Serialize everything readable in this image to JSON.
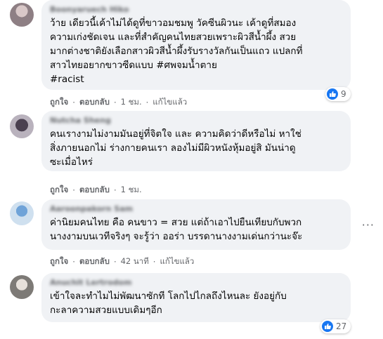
{
  "comments": [
    {
      "author": "Boonyaruech Hiko",
      "text": "ว้าย เดียวนี้เค้าไม่ได้ดูที่ขาวอมชมพู วัคซีนผิวนะ เค้าดูที่สมอง\nความเก่งชัดเจน และที่สำคัญคนไทยสวยเพราะผิวสีน้ำผึ้ง สวย\nมากต่างชาติยังเลือกสาวผิวสีน้ำผึ้งรับรางวัลกันเป็นแถว แปลกที่\nสาวไทยอยากขาวซีดแบบ #ศพจมน้ำตาย\n#racist",
      "like": "ถูกใจ",
      "reply": "ตอบกลับ",
      "time": "1 ชม.",
      "edited": "แก้ไขแล้ว",
      "reactions": "9"
    },
    {
      "author": "Nutcha Sheng",
      "text": "คนเรางามไม่งามมันอยู่ที่จิตใจ และ ความคิดว่าดีหรือไม่ หาใช่\nสิ่งภายนอกไม่ ร่างกายคนเรา ลองไม่มีผิวหนังหุ้มอยู่สิ มันน่าดู\nซะเมื่อไหร่",
      "like": "ถูกใจ",
      "reply": "ตอบกลับ",
      "time": "1 ชม."
    },
    {
      "author": "Aaroonpakorn Sam",
      "text": "ค่านิยมคนไทย คือ คนขาว = สวย แต่ถ้าเอาไปยืนเทียบกับพวก\nนางงามบนเวทีจริงๆ จะรู้ว่า ออร่า บรรดานางงามเด่นกว่านะจ๊ะ",
      "like": "ถูกใจ",
      "reply": "ตอบกลับ",
      "time": "42 นาที",
      "edited": "แก้ไขแล้ว",
      "more": "···"
    },
    {
      "author": "Anuchit Lertrodom",
      "text": "เข้าใจละทำไมไม่พัฒนาซักที โลกไปไกลถึงไหนละ ยังอยู่กับ\nกะลาความสวยแบบเดิมๆอีก",
      "reactions": "27"
    }
  ],
  "dot": "·",
  "colors": {
    "like_blue": "#1877f2",
    "bubble": "#f0f2f5",
    "meta": "#65676b"
  }
}
